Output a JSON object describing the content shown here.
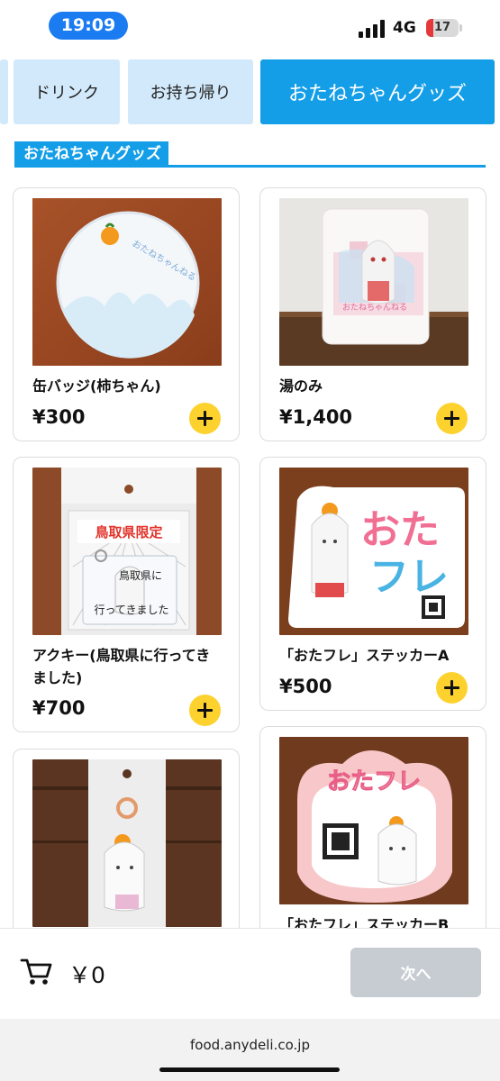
{
  "status_bar": {
    "time": "19:09",
    "network": "4G",
    "battery": "17"
  },
  "tabs": [
    {
      "label": ""
    },
    {
      "label": "ドリンク"
    },
    {
      "label": "お持ち帰り"
    },
    {
      "label": "おたねちゃんグッズ"
    }
  ],
  "section": {
    "title": "おたねちゃんグッズ"
  },
  "products": [
    {
      "name": "缶バッジ(柿ちゃん)",
      "price": "¥300",
      "image": "button-badge-photo"
    },
    {
      "name": "湯のみ",
      "price": "¥1,400",
      "image": "teacup-photo"
    },
    {
      "name": "アクキー(鳥取県に行ってきました)",
      "price": "¥700",
      "image": "acrylic-keychain-photo",
      "image_text": [
        "鳥取県限定",
        "鳥取県に",
        "行ってきました"
      ]
    },
    {
      "name": "「おたフレ」ステッカーA",
      "price": "¥500",
      "image": "sticker-a-photo",
      "image_text": [
        "おた",
        "フレ"
      ]
    },
    {
      "name": "",
      "price": "",
      "image": "acrylic-stand-photo"
    },
    {
      "name": "「おたフレ」ステッカーB",
      "price": "",
      "image": "sticker-b-photo",
      "image_text": [
        "おたフレ"
      ]
    }
  ],
  "cart": {
    "total": "￥0",
    "next_label": "次へ"
  },
  "browser": {
    "url": "food.anydeli.co.jp"
  },
  "colors": {
    "accent": "#149ee7",
    "tab_inactive": "#d2e9fb",
    "add_button": "#fdd22e",
    "next_disabled": "#c6ccd2",
    "time_pill": "#1b7cf2"
  }
}
